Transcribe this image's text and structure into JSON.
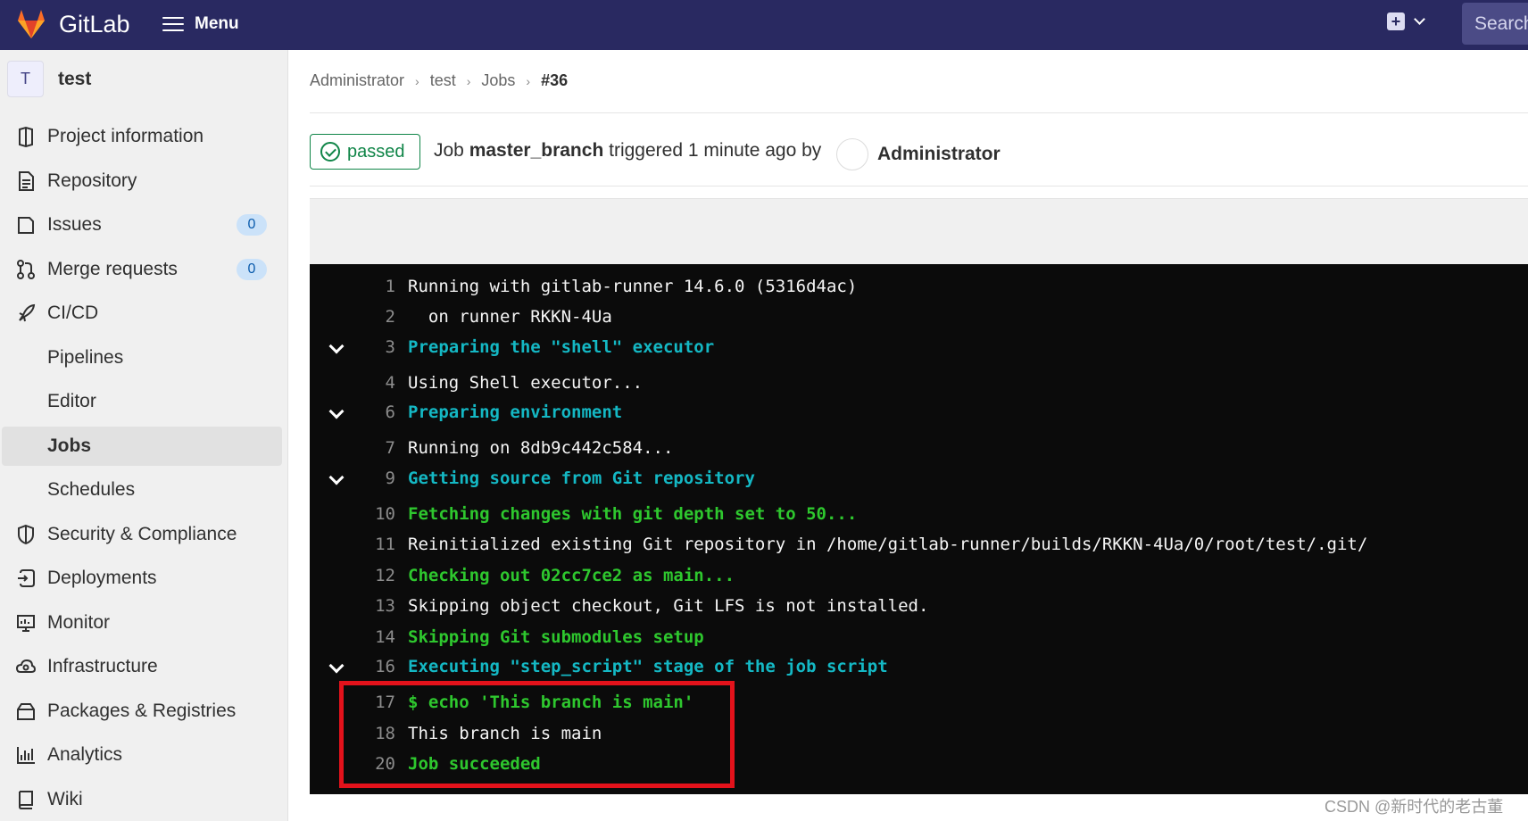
{
  "topbar": {
    "brand": "GitLab",
    "menu_label": "Menu",
    "search_placeholder": "Search",
    "logo_icon": "gitlab-tanuki-icon",
    "plus_icon": "plus-square-icon"
  },
  "sidebar": {
    "project_avatar": "T",
    "project_name": "test",
    "items": [
      {
        "label": "Project information",
        "icon": "project-icon"
      },
      {
        "label": "Repository",
        "icon": "doc-text-icon"
      },
      {
        "label": "Issues",
        "icon": "issues-icon",
        "badge": "0"
      },
      {
        "label": "Merge requests",
        "icon": "merge-request-icon",
        "badge": "0"
      },
      {
        "label": "CI/CD",
        "icon": "rocket-icon"
      },
      {
        "label": "Pipelines"
      },
      {
        "label": "Editor"
      },
      {
        "label": "Jobs",
        "active": true
      },
      {
        "label": "Schedules"
      },
      {
        "label": "Security & Compliance",
        "icon": "shield-icon"
      },
      {
        "label": "Deployments",
        "icon": "deployments-icon"
      },
      {
        "label": "Monitor",
        "icon": "monitor-icon"
      },
      {
        "label": "Infrastructure",
        "icon": "cloud-gear-icon"
      },
      {
        "label": "Packages & Registries",
        "icon": "package-icon"
      },
      {
        "label": "Analytics",
        "icon": "chart-icon"
      },
      {
        "label": "Wiki",
        "icon": "book-icon"
      }
    ]
  },
  "breadcrumb": [
    "Administrator",
    "test",
    "Jobs",
    "#36"
  ],
  "job": {
    "status": "passed",
    "prefix": "Job ",
    "name": "master_branch",
    "triggered": " triggered 1 minute ago by",
    "user": "Administrator"
  },
  "log": [
    {
      "num": "1",
      "text": "Running with gitlab-runner 14.6.0 (5316d4ac)",
      "style": "plain"
    },
    {
      "num": "2",
      "text": "  on runner RKKN-4Ua",
      "style": "plain"
    },
    {
      "num": "3",
      "text": "Preparing the \"shell\" executor",
      "style": "cyan",
      "collapsible": true
    },
    {
      "num": "4",
      "text": "Using Shell executor...",
      "style": "plain"
    },
    {
      "num": "6",
      "text": "Preparing environment",
      "style": "cyan",
      "collapsible": true
    },
    {
      "num": "7",
      "text": "Running on 8db9c442c584...",
      "style": "plain"
    },
    {
      "num": "9",
      "text": "Getting source from Git repository",
      "style": "cyan",
      "collapsible": true
    },
    {
      "num": "10",
      "text": "Fetching changes with git depth set to 50...",
      "style": "green"
    },
    {
      "num": "11",
      "text": "Reinitialized existing Git repository in /home/gitlab-runner/builds/RKKN-4Ua/0/root/test/.git/",
      "style": "plain"
    },
    {
      "num": "12",
      "text": "Checking out 02cc7ce2 as main...",
      "style": "green"
    },
    {
      "num": "13",
      "text": "Skipping object checkout, Git LFS is not installed.",
      "style": "plain"
    },
    {
      "num": "14",
      "text": "Skipping Git submodules setup",
      "style": "green"
    },
    {
      "num": "16",
      "text": "Executing \"step_script\" stage of the job script",
      "style": "cyan",
      "collapsible": true
    },
    {
      "num": "17",
      "text": "$ echo 'This branch is main'",
      "style": "green"
    },
    {
      "num": "18",
      "text": "This branch is main",
      "style": "plain"
    },
    {
      "num": "20",
      "text": "Job succeeded",
      "style": "green"
    }
  ],
  "watermark": "CSDN @新时代的老古董"
}
